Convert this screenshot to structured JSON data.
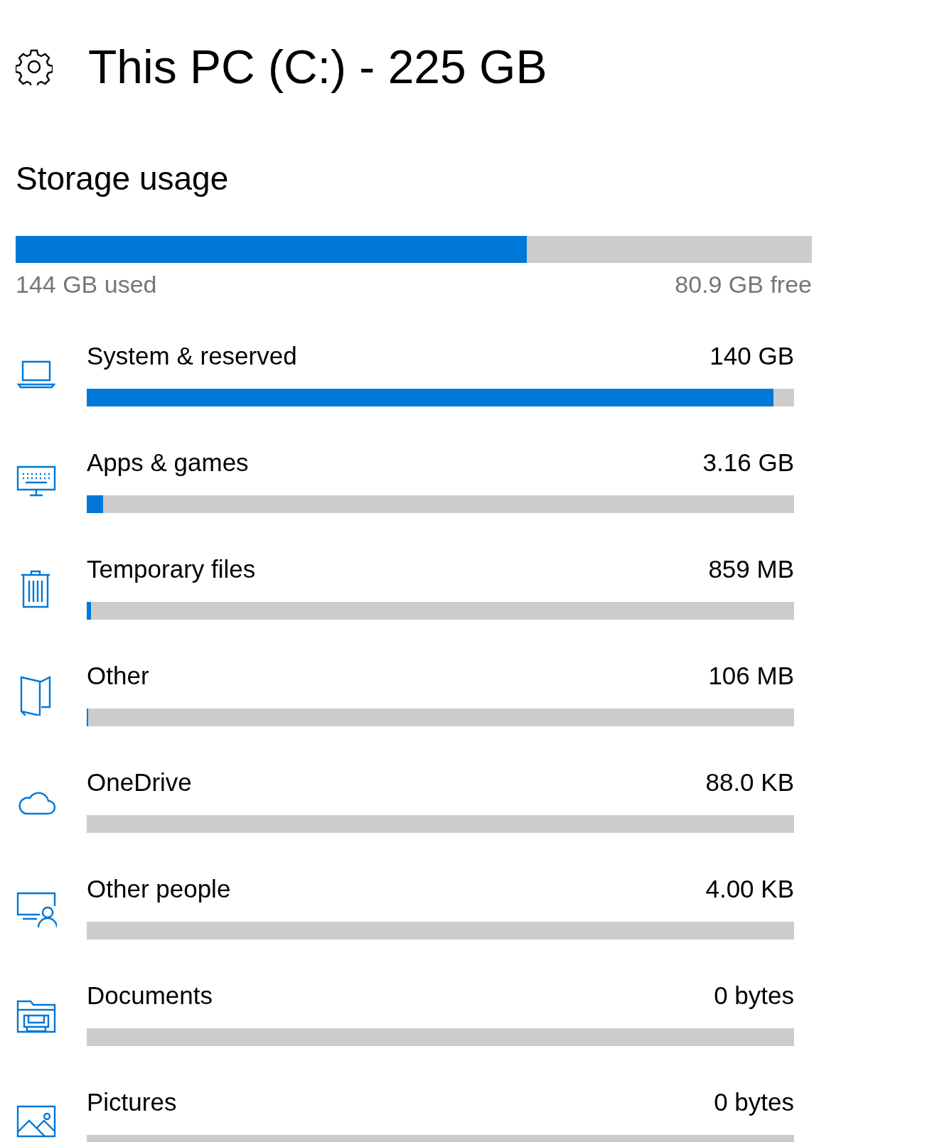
{
  "header": {
    "title": "This PC (C:) - 225 GB"
  },
  "storage_usage": {
    "heading": "Storage usage",
    "level": 0.642,
    "used": "144 GB used",
    "free": "80.9 GB free"
  },
  "categories": [
    {
      "label": "System & reserved",
      "size": "140 GB",
      "level": 0.971
    },
    {
      "label": "Apps & games",
      "size": "3.16 GB",
      "level": 0.023
    },
    {
      "label": "Temporary files",
      "size": "859 MB",
      "level": 0.006
    },
    {
      "label": "Other",
      "size": "106 MB",
      "level": 0.002
    },
    {
      "label": "OneDrive",
      "size": "88.0 KB",
      "level": 0
    },
    {
      "label": "Other people",
      "size": "4.00 KB",
      "level": 0
    },
    {
      "label": "Documents",
      "size": "0 bytes",
      "level": 0
    },
    {
      "label": "Pictures",
      "size": "0 bytes",
      "level": 0
    }
  ]
}
